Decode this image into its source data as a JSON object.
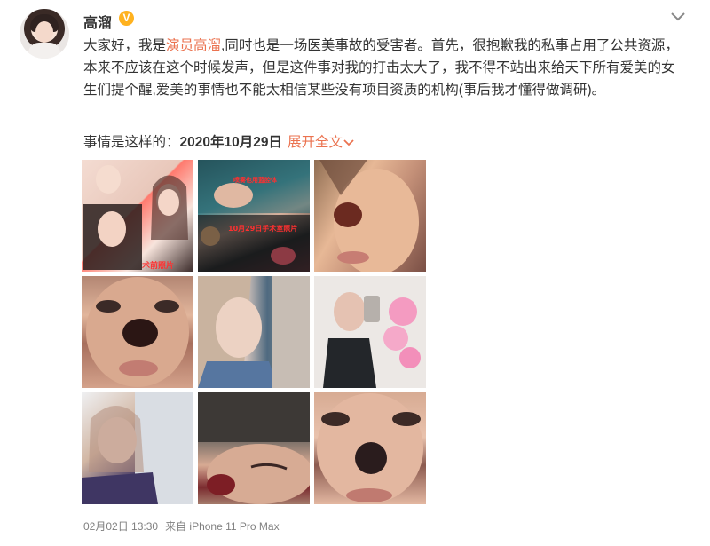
{
  "post": {
    "author": "高溜",
    "verified_mark": "V",
    "text_intro": "大家好，我是",
    "text_highlight": "演员高溜",
    "text_rest": ",同时也是一场医美事故的受害者。首先，很抱歉我的私事占用了公共资源，本来不应该在这个时候发声，但是这件事对我的打击太大了，我不得不站出来给天下所有爱美的女生们提个醒,爱美的事情也不能太相信某些没有项目资质的机构(事后我才懂得做调研)。",
    "date_prefix": "事情是这样的：",
    "date": "2020年10月29日",
    "expand_label": "展开全文",
    "photos": [
      {
        "name": "photo-1",
        "caption": "术前照片"
      },
      {
        "name": "photo-2",
        "caption": "10月29日手术室照片",
        "caption2": "喷雾也用蓝腔体"
      },
      {
        "name": "photo-3"
      },
      {
        "name": "photo-4"
      },
      {
        "name": "photo-5"
      },
      {
        "name": "photo-6"
      },
      {
        "name": "photo-7"
      },
      {
        "name": "photo-8"
      },
      {
        "name": "photo-9"
      }
    ],
    "footer": {
      "time": "02月02日 13:30",
      "source": "来自 iPhone 11 Pro Max"
    }
  },
  "colors": {
    "accent": "#eb7350",
    "verified": "#ffb21f",
    "footer_text": "#808080"
  },
  "icons": {
    "verified": "verified-badge-icon",
    "menu": "chevron-down-icon",
    "expand": "chevron-down-icon"
  }
}
